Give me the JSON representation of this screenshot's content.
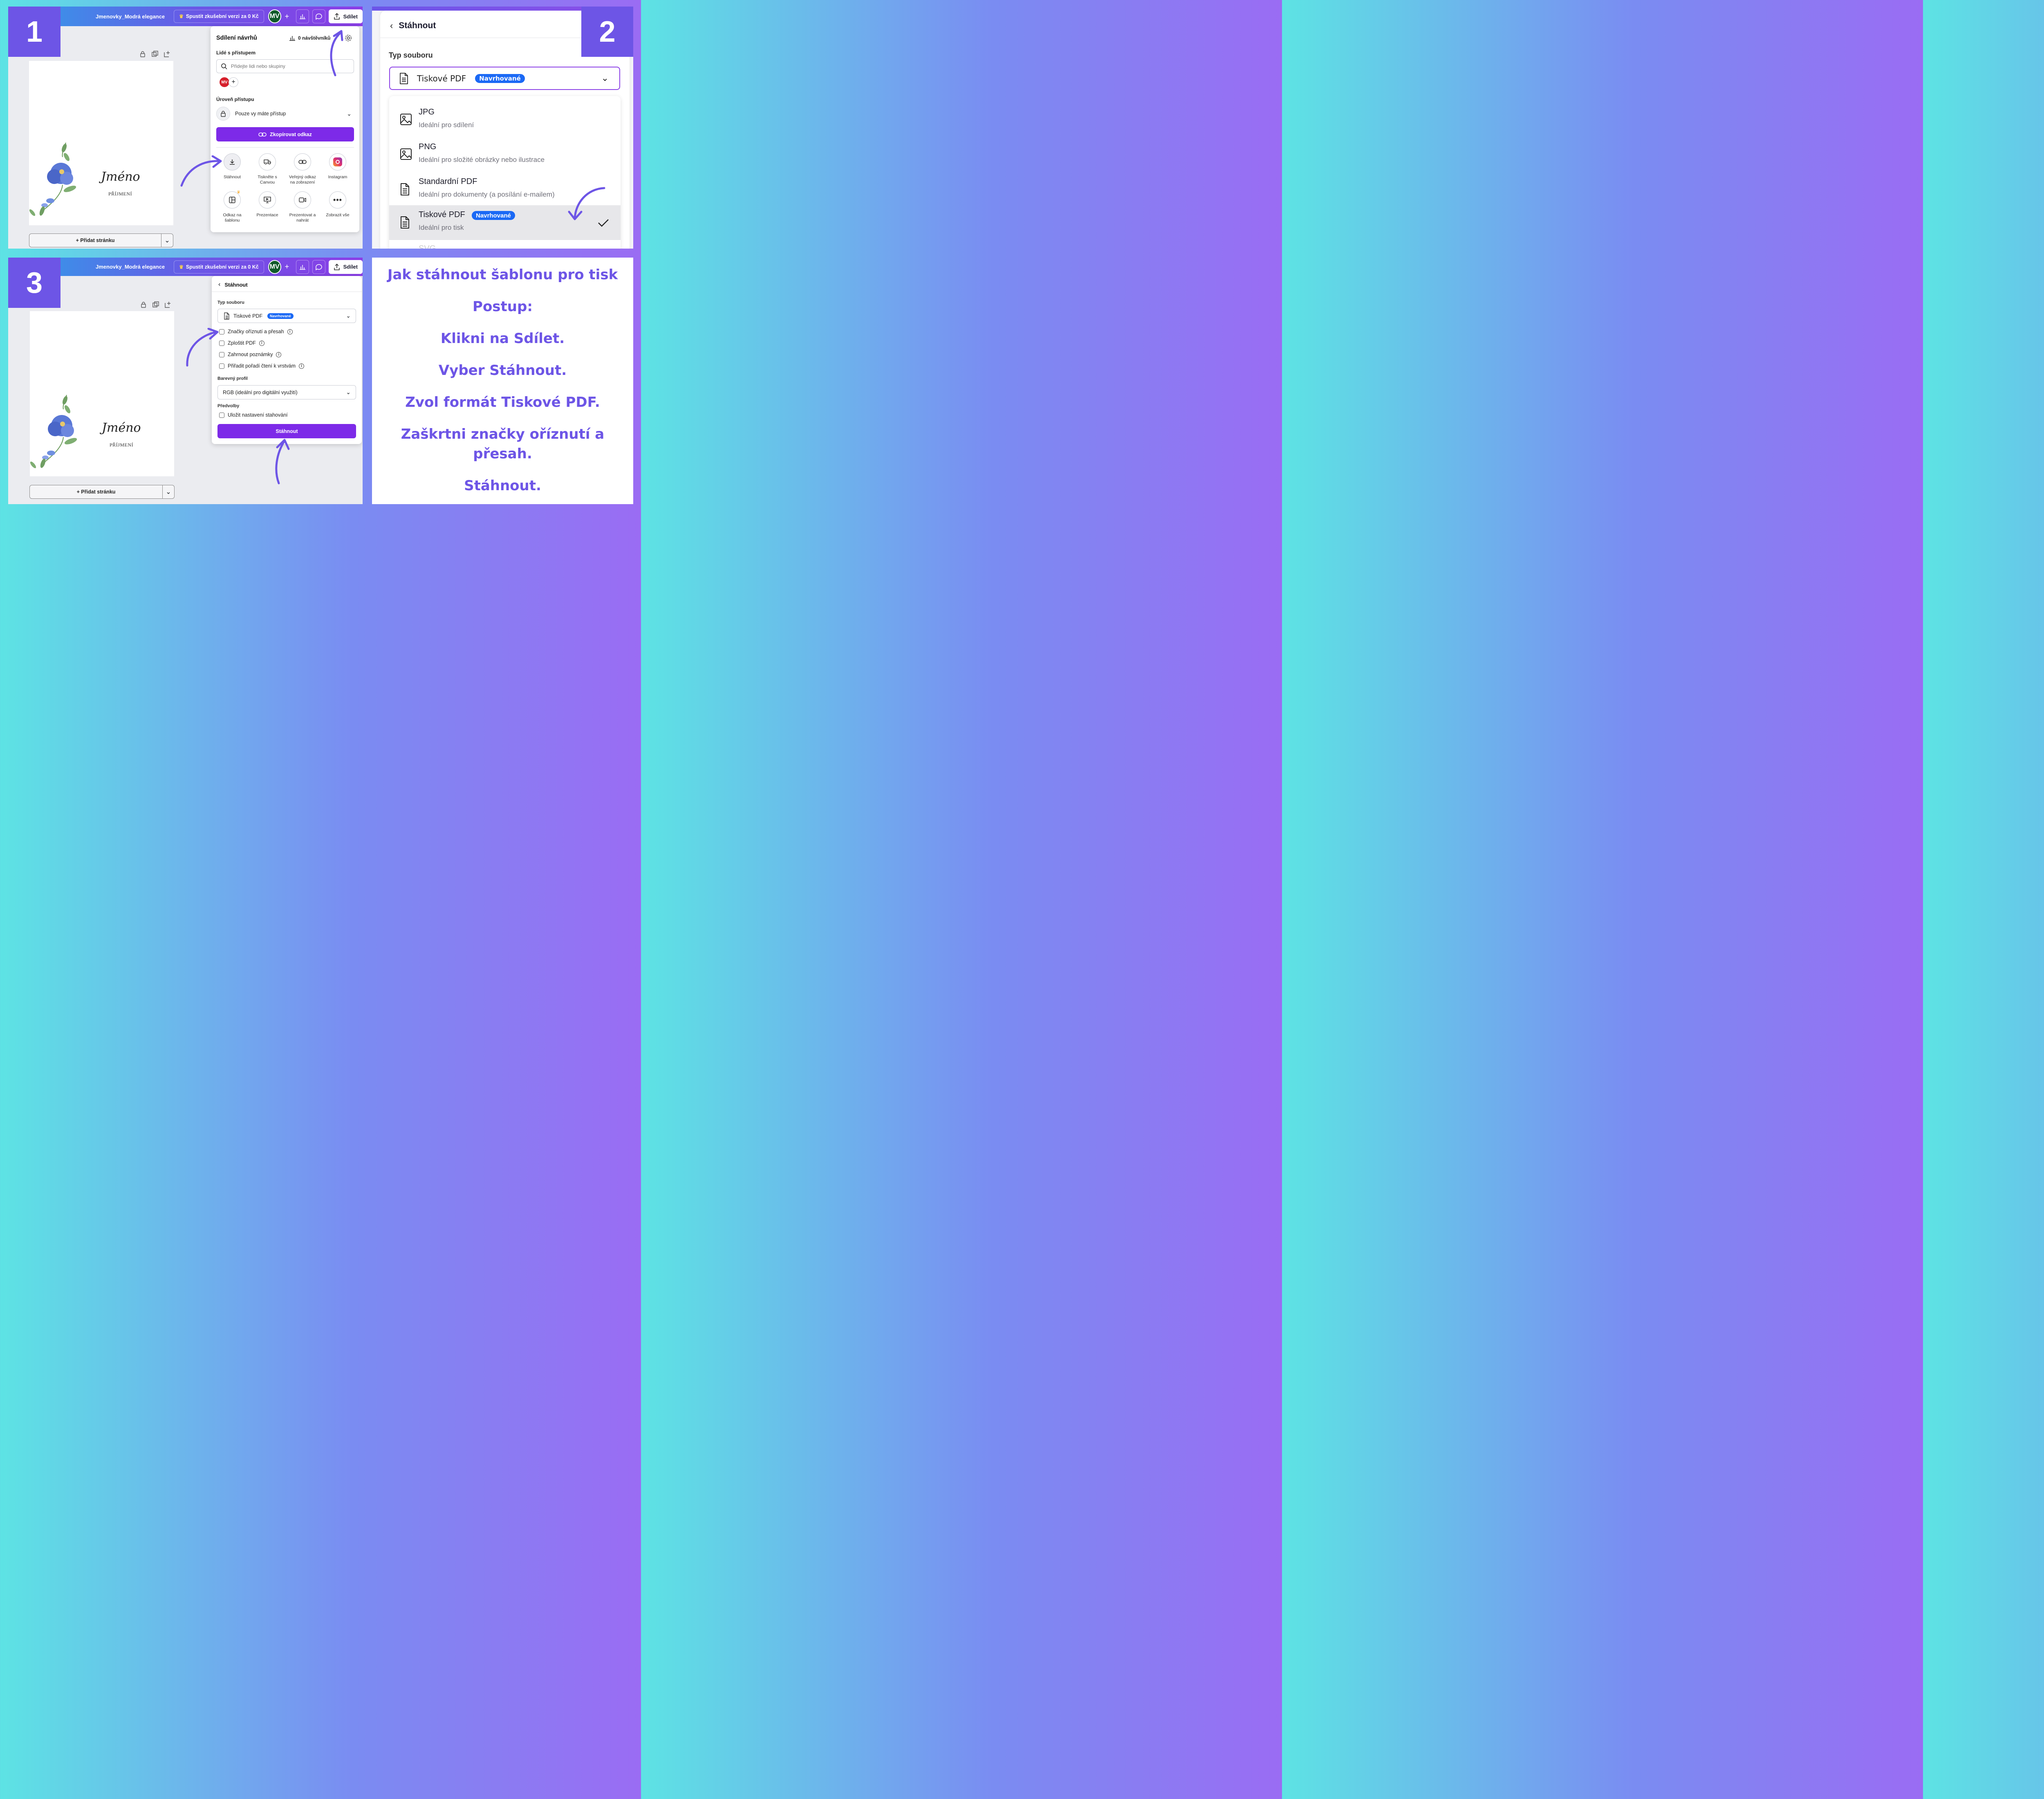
{
  "panel1": {
    "badge": "1",
    "editor": {
      "title": "Jmenovky_Modrá elegance",
      "trial": "Spustit zkušební verzi za 0 Kč",
      "avatar": "MV",
      "share": "Sdílet",
      "name": "Jméno",
      "surname": "PŘÍJMENÍ",
      "add_page": "+ Přidat stránku"
    },
    "share_popup": {
      "title": "Sdílení návrhů",
      "visitors": "0 návštěvníků",
      "people_label": "Lidé s přístupem",
      "search_placeholder": "Přidejte lidi nebo skupiny",
      "avatar": "MV",
      "access_label": "Úroveň přístupu",
      "access_value": "Pouze vy máte přístup",
      "copy_link": "Zkopírovat odkaz",
      "options": [
        {
          "label": "Stáhnout",
          "icon": "download-icon"
        },
        {
          "label": "Tiskněte s Canvou",
          "icon": "truck-icon"
        },
        {
          "label": "Veřejný odkaz na zobrazení",
          "icon": "link-icon"
        },
        {
          "label": "Instagram",
          "icon": "instagram-icon"
        },
        {
          "label": "Odkaz na šablonu",
          "icon": "template-icon"
        },
        {
          "label": "Prezentace",
          "icon": "presentation-icon"
        },
        {
          "label": "Prezentovat a nahrát",
          "icon": "record-icon"
        },
        {
          "label": "Zobrazit vše",
          "icon": "more-icon"
        }
      ]
    }
  },
  "panel2": {
    "badge": "2",
    "back_title": "Stáhnout",
    "type_label": "Typ souboru",
    "selected": "Tiskové PDF",
    "selected_tag": "Navrhované",
    "options": [
      {
        "title": "JPG",
        "desc": "Ideální pro sdílení",
        "icon": "image-icon"
      },
      {
        "title": "PNG",
        "desc": "Ideální pro složité obrázky nebo ilustrace",
        "icon": "image-icon"
      },
      {
        "title": "Standardní PDF",
        "desc": "Ideální pro dokumenty (a posílání e-mailem)",
        "icon": "document-icon"
      },
      {
        "title": "Tiskové PDF",
        "tag": "Navrhované",
        "desc": "Ideální pro tisk",
        "icon": "document-icon",
        "selected": true
      }
    ]
  },
  "panel3": {
    "badge": "3",
    "editor": {
      "title": "Jmenovky_Modrá elegance",
      "trial": "Spustit zkušební verzi za 0 Kč",
      "avatar": "MV",
      "share": "Sdílet",
      "name": "Jméno",
      "surname": "PŘÍJMENÍ",
      "add_page": "+ Přidat stránku"
    },
    "download_popup": {
      "back_title": "Stáhnout",
      "type_label": "Typ souboru",
      "type_value": "Tiskové PDF",
      "type_tag": "Navrhované",
      "checkboxes": [
        {
          "label": "Značky oříznutí a přesah",
          "info": true
        },
        {
          "label": "Zploštit PDF",
          "info": true
        },
        {
          "label": "Zahrnout poznámky",
          "info": true
        },
        {
          "label": "Přiřadit pořadí čtení k vrstvám",
          "info": true
        }
      ],
      "color_label": "Barevný profil",
      "color_value": "RGB (ideální pro digitální využití)",
      "presets_label": "Předvolby",
      "save_settings": "Uložit nastavení stahování",
      "download_button": "Stáhnout"
    }
  },
  "panel4": {
    "title": "Jak stáhnout šablonu pro tisk",
    "steps": [
      "Postup:",
      "Klikni na Sdílet.",
      "Vyber Stáhnout.",
      "Zvol formát Tiskové PDF.",
      "Zaškrtni značky oříznutí a přesah.",
      "Stáhnout."
    ]
  },
  "colors": {
    "accent": "#6d55e6",
    "canva_purple": "#7d2ae8",
    "tag_blue": "#1b69f5"
  }
}
